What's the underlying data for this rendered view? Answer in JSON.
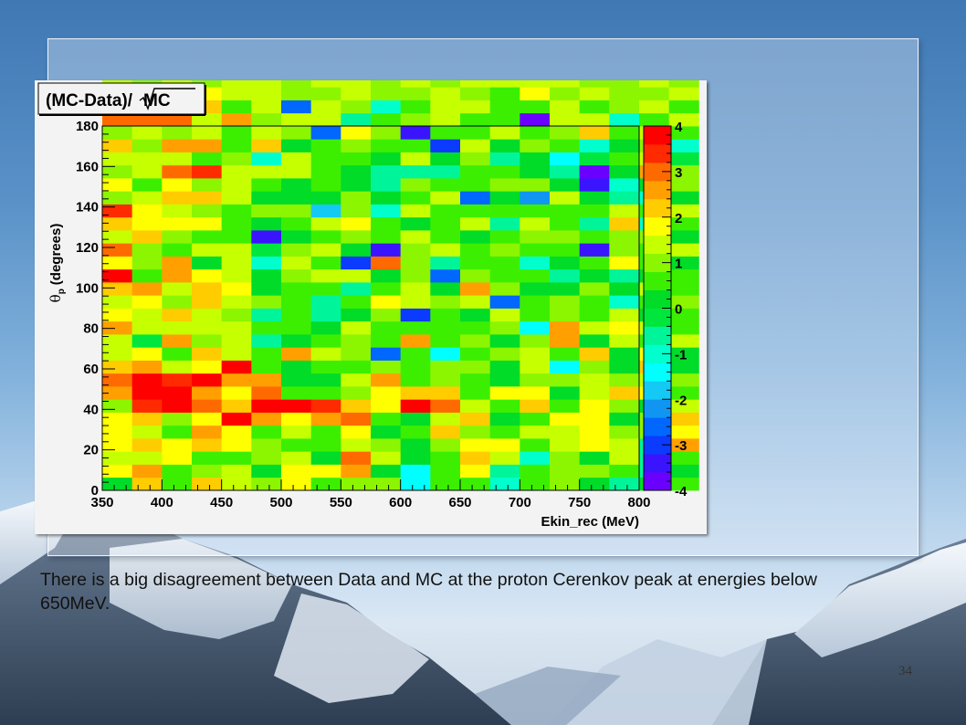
{
  "slide": {
    "caption": "There is a big disagreement between Data and MC at the proton Cerenkov peak at energies below 650MeV.",
    "page_number": "34"
  },
  "chart_data": {
    "type": "heatmap",
    "title": "(MC-Data)/√MC",
    "title_prefix": "(MC-Data)/",
    "title_sqrt_arg": "MC",
    "xlabel": "Ekin_rec (MeV)",
    "ylabel_theta": "θ",
    "ylabel_sub": "p",
    "ylabel_rest": "(degrees)",
    "xlim": [
      350,
      800
    ],
    "ylim": [
      0,
      180
    ],
    "x_ticks": [
      350,
      400,
      450,
      500,
      550,
      600,
      650,
      700,
      750,
      800
    ],
    "y_ticks": [
      0,
      20,
      40,
      60,
      80,
      100,
      120,
      140,
      160,
      180
    ],
    "x_bin_width": 25,
    "y_bin_width": 6.4286,
    "color_range": [
      -4,
      4
    ],
    "colorbar_ticks": [
      -4,
      -3,
      -2,
      -1,
      0,
      1,
      2,
      3,
      4
    ],
    "colorbar_labels": [
      "-4",
      "-3",
      "-2",
      "-1",
      "0",
      "1",
      "2",
      "3",
      "4"
    ],
    "palette": [
      "#6a00ff",
      "#3b14ff",
      "#0b3bff",
      "#0067ff",
      "#1096f2",
      "#15c9f5",
      "#00ffff",
      "#00ffcc",
      "#00f59a",
      "#00e63c",
      "#00dc28",
      "#3cef00",
      "#8cf500",
      "#c6ff00",
      "#ffff00",
      "#ffcc00",
      "#ffa000",
      "#ff6a00",
      "#ff2a00",
      "#ff0000"
    ],
    "z_rows_bottom_to_top": [
      [
        0.3,
        2.2,
        0.6,
        2.1,
        1.3,
        1.1,
        1.9,
        0.5,
        1.1,
        0.8,
        -1.3,
        0.4,
        0.6,
        -0.9,
        0.7,
        1.1,
        0.3,
        -0.8,
        0.2,
        0.7
      ],
      [
        1.7,
        2.6,
        0.4,
        1.1,
        1.4,
        0.2,
        1.6,
        1.8,
        2.4,
        0.2,
        -1.3,
        0.6,
        1.7,
        -0.6,
        0.4,
        0.9,
        0.9,
        0.5,
        -0.6,
        0.1
      ],
      [
        1.2,
        1.4,
        1.7,
        0.7,
        0.4,
        0.8,
        1.2,
        0.1,
        2.9,
        1.5,
        0.1,
        0.6,
        2.0,
        1.4,
        -1.2,
        1.0,
        0.1,
        1.2,
        -0.6,
        0.7
      ],
      [
        1.6,
        2.1,
        1.6,
        2.3,
        1.8,
        0.8,
        0.4,
        0.7,
        1.3,
        0.9,
        0.1,
        0.9,
        1.6,
        1.9,
        0.7,
        1.3,
        1.7,
        1.2,
        -0.8,
        2.7
      ],
      [
        1.6,
        1.4,
        0.7,
        2.7,
        1.6,
        0.6,
        1.2,
        0.5,
        1.6,
        0.3,
        0.4,
        2.1,
        1.1,
        0.6,
        1.2,
        1.5,
        1.6,
        1.0,
        1.0,
        1.8
      ],
      [
        1.9,
        2.2,
        1.1,
        1.6,
        3.6,
        2.7,
        1.9,
        2.6,
        2.9,
        0.6,
        0.2,
        1.2,
        2.0,
        0.3,
        0.5,
        1.9,
        1.6,
        0.2,
        1.1,
        2.0
      ],
      [
        1.1,
        3.5,
        3.6,
        2.9,
        2.3,
        3.6,
        3.6,
        3.4,
        2.2,
        1.6,
        3.6,
        2.8,
        1.5,
        0.4,
        2.0,
        0.6,
        1.8,
        0.9,
        0.3,
        1.4
      ],
      [
        2.4,
        3.7,
        3.6,
        2.4,
        1.6,
        2.9,
        0.7,
        0.4,
        0.8,
        1.7,
        2.1,
        2.0,
        0.5,
        1.6,
        1.9,
        0.2,
        1.2,
        2.3,
        1.6,
        0.6
      ],
      [
        2.9,
        3.6,
        3.4,
        3.6,
        2.5,
        2.4,
        0.3,
        0.2,
        1.3,
        2.4,
        0.7,
        1.1,
        0.6,
        0.3,
        1.0,
        1.0,
        1.2,
        0.8,
        1.5,
        0.8
      ],
      [
        2.2,
        2.4,
        1.5,
        1.7,
        3.7,
        0.6,
        0.2,
        0.5,
        0.4,
        0.9,
        0.6,
        1.0,
        0.8,
        0.3,
        1.2,
        -1.5,
        1.1,
        0.1,
        2.0,
        0.1
      ],
      [
        1.3,
        1.6,
        0.6,
        2.2,
        1.4,
        0.4,
        2.4,
        1.2,
        0.8,
        -2.7,
        0.4,
        -1.6,
        0.5,
        1.1,
        1.5,
        0.7,
        2.3,
        0.3,
        1.7,
        0.2
      ],
      [
        1.4,
        -0.4,
        2.6,
        0.8,
        1.2,
        -0.8,
        0.2,
        0.6,
        0.8,
        0.7,
        2.5,
        0.6,
        0.9,
        0.2,
        0.9,
        2.6,
        0.3,
        1.3,
        0.6,
        1.4
      ],
      [
        2.4,
        1.2,
        1.3,
        1.5,
        1.3,
        0.6,
        0.4,
        0.3,
        1.3,
        0.6,
        0.6,
        0.5,
        0.5,
        0.8,
        -1.3,
        2.4,
        1.4,
        1.6,
        1.3,
        0.6
      ],
      [
        1.6,
        1.3,
        2.0,
        1.5,
        1.1,
        -0.7,
        0.5,
        -0.6,
        0.2,
        0.8,
        -2.9,
        0.6,
        0.1,
        1.2,
        0.5,
        1.1,
        0.4,
        1.5,
        0.2,
        0.7
      ],
      [
        1.4,
        1.6,
        1.1,
        2.1,
        1.2,
        1.0,
        0.7,
        -0.7,
        0.6,
        1.6,
        1.2,
        0.8,
        1.2,
        -2.6,
        0.7,
        0.9,
        0.4,
        -0.9,
        0.6,
        0.9
      ],
      [
        2.3,
        2.6,
        1.4,
        2.2,
        1.6,
        0.2,
        0.6,
        0.7,
        -0.8,
        0.4,
        1.2,
        0.1,
        2.4,
        1.1,
        0.3,
        0.1,
        1.1,
        0.1,
        1.4,
        0.4
      ],
      [
        3.6,
        0.7,
        2.4,
        1.7,
        1.4,
        0.2,
        0.8,
        1.5,
        1.2,
        0.3,
        0.9,
        -2.5,
        0.8,
        0.6,
        0.4,
        -0.6,
        0.3,
        -0.8,
        0.2,
        0.4
      ],
      [
        1.6,
        0.8,
        2.5,
        0.1,
        1.4,
        -0.9,
        1.4,
        0.6,
        -3.0,
        2.8,
        0.9,
        -0.6,
        0.4,
        0.6,
        -0.9,
        0.1,
        0.5,
        1.7,
        0.6,
        0.3
      ],
      [
        2.9,
        1.1,
        0.4,
        1.4,
        1.2,
        -0.3,
        1.1,
        1.4,
        0.1,
        -3.2,
        0.8,
        1.2,
        0.6,
        1.0,
        0.6,
        0.7,
        -3.4,
        0.8,
        0.7,
        1.4
      ],
      [
        1.3,
        2.1,
        0.8,
        0.4,
        0.7,
        -3.4,
        0.2,
        0.6,
        0.9,
        0.4,
        1.3,
        0.7,
        0.3,
        0.5,
        0.8,
        1.0,
        0.4,
        0.8,
        1.1,
        0.2
      ],
      [
        2.1,
        1.8,
        1.9,
        1.7,
        0.4,
        0.3,
        0.5,
        1.2,
        1.7,
        0.6,
        0.3,
        0.6,
        1.4,
        -0.7,
        1.2,
        0.4,
        -0.8,
        2.1,
        -0.9,
        0.7
      ],
      [
        3.3,
        1.6,
        1.3,
        0.8,
        0.4,
        1.0,
        1.1,
        -1.9,
        0.8,
        -1.2,
        1.2,
        0.5,
        0.4,
        0.7,
        0.6,
        0.6,
        0.7,
        1.3,
        0.5,
        1.3
      ],
      [
        1.1,
        1.4,
        2.1,
        2.1,
        1.4,
        0.3,
        0.3,
        0.1,
        0.9,
        0.1,
        0.7,
        1.4,
        -2.8,
        0.3,
        -2.2,
        1.2,
        0.2,
        -0.7,
        -0.9,
        0.1
      ],
      [
        1.6,
        0.7,
        1.9,
        1.1,
        1.3,
        0.6,
        0.2,
        0.4,
        0.1,
        -0.8,
        0.8,
        0.5,
        0.6,
        0.9,
        0.9,
        0.2,
        -3.4,
        -0.9,
        0.2,
        1.1
      ],
      [
        0.8,
        1.4,
        2.9,
        3.3,
        1.2,
        1.3,
        1.2,
        0.6,
        0.3,
        -0.7,
        -0.6,
        -0.8,
        0.7,
        0.4,
        0.3,
        -0.5,
        -3.6,
        0.3,
        2.4,
        0.9
      ],
      [
        1.4,
        1.2,
        1.4,
        0.6,
        1.1,
        -0.9,
        1.2,
        0.6,
        0.4,
        0.1,
        1.5,
        0.2,
        0.8,
        -0.8,
        0.2,
        -1.3,
        -0.4,
        0.5,
        1.4,
        -0.4
      ],
      [
        2.1,
        1.0,
        2.6,
        2.6,
        0.6,
        2.0,
        0.3,
        0.7,
        0.8,
        0.6,
        0.4,
        -3.0,
        1.2,
        0.3,
        1.1,
        0.4,
        -1.2,
        0.3,
        0.8,
        -1.0
      ],
      [
        1.1,
        1.3,
        1.0,
        1.4,
        0.4,
        1.3,
        0.8,
        -2.7,
        1.9,
        0.8,
        -3.5,
        0.6,
        0.6,
        1.2,
        0.5,
        1.1,
        2.3,
        0.5,
        1.3,
        0.4
      ],
      [
        2.8,
        3.1,
        3.1,
        1.3,
        2.4,
        0.8,
        1.2,
        1.2,
        -0.8,
        0.5,
        0.9,
        1.4,
        0.7,
        0.6,
        -3.6,
        1.3,
        1.4,
        -1.0,
        0.7,
        1.2
      ],
      [
        0.2,
        0.6,
        0.3,
        2.3,
        0.6,
        1.2,
        -2.8,
        1.3,
        0.8,
        -0.9,
        0.4,
        1.2,
        1.3,
        0.4,
        0.4,
        1.3,
        0.4,
        1.1,
        1.4,
        0.6
      ],
      [
        0.4,
        1.1,
        1.1,
        1.7,
        1.3,
        1.2,
        1.1,
        0.8,
        1.3,
        0.9,
        0.8,
        1.2,
        1.1,
        0.6,
        1.6,
        1.1,
        1.3,
        0.9,
        0.9,
        1.2
      ],
      [
        1.4,
        0.9,
        1.3,
        1.0,
        1.4,
        1.2,
        1.0,
        1.4,
        1.5,
        1.0,
        1.2,
        0.8,
        1.3,
        1.2,
        1.2,
        1.4,
        1.1,
        1.0,
        1.3,
        1.1
      ],
      [
        0.6,
        1.2,
        0.9,
        1.3,
        0.8,
        1.1,
        1.4,
        1.2,
        0.9,
        1.5,
        1.1,
        1.3,
        1.0,
        1.1,
        0.8,
        1.2,
        1.4,
        1.2,
        0.9,
        1.3
      ],
      [
        1.2,
        1.4,
        1.1,
        0.9,
        1.2,
        1.0,
        1.2,
        1.1,
        1.3,
        1.2,
        1.4,
        1.1,
        1.2,
        1.3,
        1.1,
        0.9,
        1.2,
        1.4,
        1.1,
        1.0
      ],
      [
        0.8,
        1.1,
        1.4,
        1.2,
        1.0,
        1.3,
        0.9,
        1.2,
        1.4,
        1.0,
        0.9,
        1.2,
        1.4,
        1.0,
        1.3,
        1.2,
        1.0,
        1.1,
        1.4,
        1.2
      ],
      [
        1.0,
        1.3,
        1.2,
        1.1,
        1.3,
        1.2,
        1.4,
        1.0,
        1.1,
        1.3,
        1.2,
        1.0,
        1.1,
        1.4,
        1.2,
        1.1,
        1.3,
        1.2,
        1.0,
        1.4
      ]
    ]
  }
}
